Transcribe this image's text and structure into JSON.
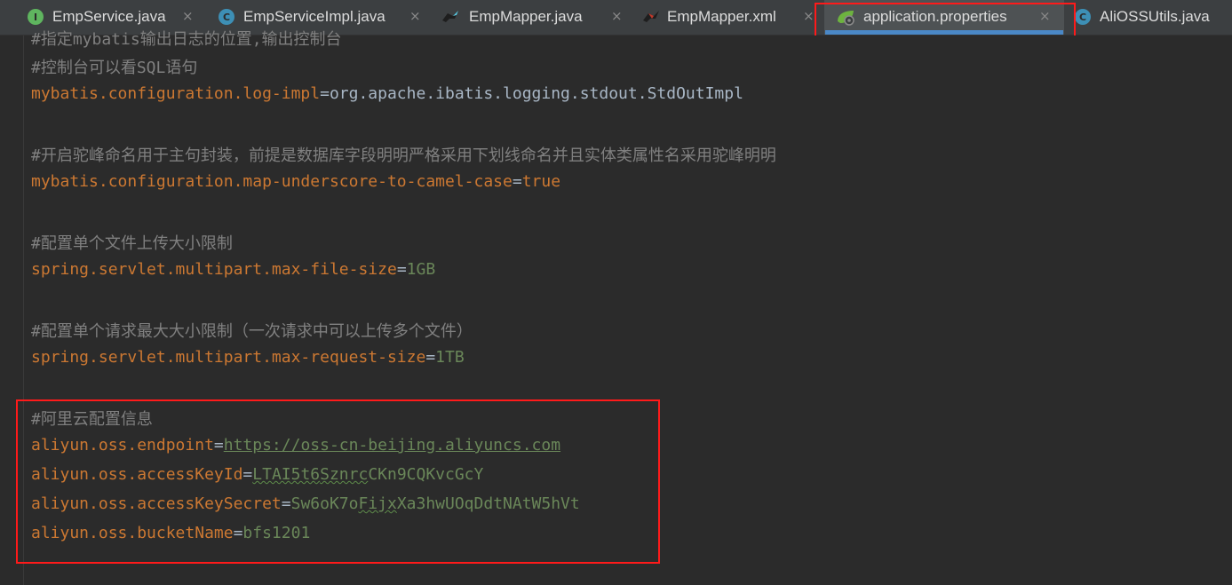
{
  "tabs": [
    {
      "label": "EmpService.java",
      "icon": "interface-icon",
      "icon_letter": "I",
      "icon_color": "#5fb55f",
      "active": false
    },
    {
      "label": "EmpServiceImpl.java",
      "icon": "class-icon",
      "icon_letter": "C",
      "icon_color": "#3d8fb5",
      "active": false
    },
    {
      "label": "EmpMapper.java",
      "icon": "mybatis-bird-icon",
      "active": false
    },
    {
      "label": "EmpMapper.xml",
      "icon": "mybatis-bird-icon",
      "active": false
    },
    {
      "label": "application.properties",
      "icon": "spring-leaf-icon",
      "active": true
    },
    {
      "label": "AliOSSUtils.java",
      "icon": "class-icon",
      "icon_letter": "C",
      "icon_color": "#3d8fb5",
      "active": false
    }
  ],
  "close_glyph": "×",
  "editor": {
    "partial_top_line": "#指定mybatis输出日志的位置,输出控制台",
    "lines": {
      "c1": "#控制台可以看SQL语句",
      "k1": "mybatis.configuration.log-impl",
      "v1": "org.apache.ibatis.logging.stdout.StdOutImpl",
      "c2": "#开启驼峰命名用于主句封装，前提是数据库字段明明严格采用下划线命名并且实体类属性名采用驼峰明明",
      "k2": "mybatis.configuration.map-underscore-to-camel-case",
      "v2": "true",
      "c3": "#配置单个文件上传大小限制",
      "k3": "spring.servlet.multipart.max-file-size",
      "v3": "1GB",
      "c4": "#配置单个请求最大大小限制（一次请求中可以上传多个文件）",
      "k4": "spring.servlet.multipart.max-request-size",
      "v4": "1TB",
      "c5": "#阿里云配置信息",
      "k5": "aliyun.oss.endpoint",
      "v5": "https://oss-cn-beijing.aliyuncs.com",
      "k6": "aliyun.oss.accessKeyId",
      "v6a": "LTAI5t6",
      "v6b": "Sznrc",
      "v6c": "CKn9CQKvcGcY",
      "k7": "aliyun.oss.accessKeySecret",
      "v7a": "Sw6oK7o",
      "v7b": "Fijx",
      "v7c": "Xa3hwUOqDdtNAtW5hVt",
      "k8": "aliyun.oss.bucketName",
      "v8": "bfs1201"
    },
    "eq": "="
  },
  "colors": {
    "highlight": "#ff1a1a",
    "key": "#cc7832",
    "value": "#6a8759",
    "comment": "#808080",
    "accent": "#4a88c7"
  }
}
